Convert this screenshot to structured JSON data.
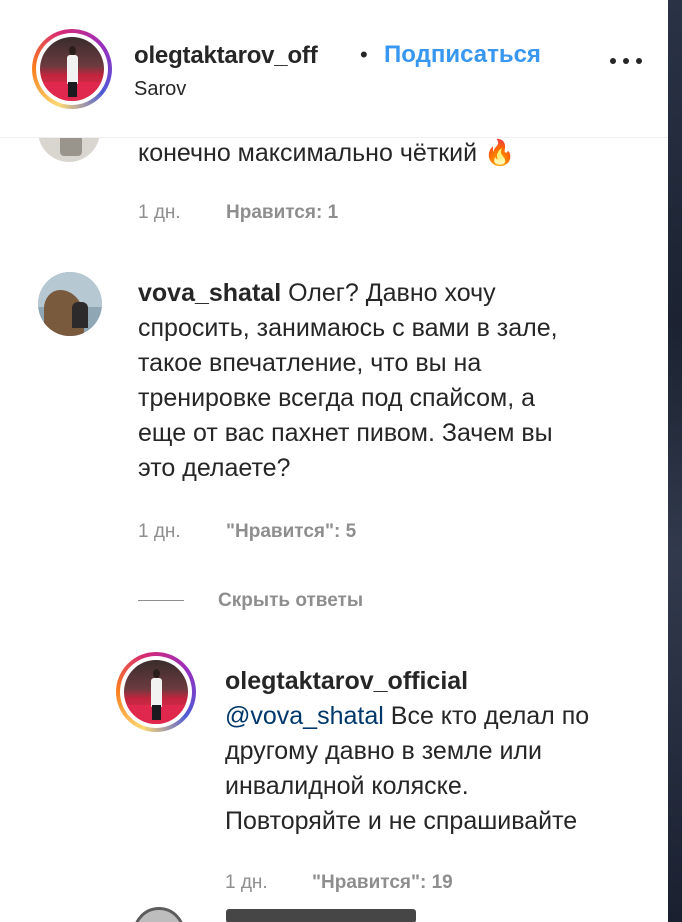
{
  "header": {
    "username": "olegtaktarov_off",
    "separator": "•",
    "follow_label": "Подписаться",
    "location": "Sarov",
    "more_icon": "ellipsis-icon"
  },
  "comments": [
    {
      "text_tail": "конечно максимально чёткий 🔥",
      "time": "1 дн.",
      "likes": "Нравится: 1"
    },
    {
      "username": "vova_shatal",
      "lines": [
        "Олег? Давно хочу",
        "спросить, занимаюсь с вами в зале,",
        "такое впечатление, что вы на",
        "тренировке всегда под спайсом, а",
        "еще от вас пахнет пивом. Зачем вы",
        "это делаете?"
      ],
      "time": "1 дн.",
      "likes": "\"Нравится\": 5",
      "hide_replies": "Скрыть ответы"
    }
  ],
  "reply": {
    "username": "olegtaktarov_official",
    "mention": "@vova_shatal",
    "lines": [
      "Все кто делал по",
      "другому давно в земле или",
      "инвалидной коляске.",
      "Повторяйте и не спрашивайте"
    ],
    "time": "1 дн.",
    "likes": "\"Нравится\": 19"
  },
  "colors": {
    "accent": "#3897f0",
    "text": "#262626",
    "muted": "#8e8e8e",
    "mention": "#00376b"
  }
}
